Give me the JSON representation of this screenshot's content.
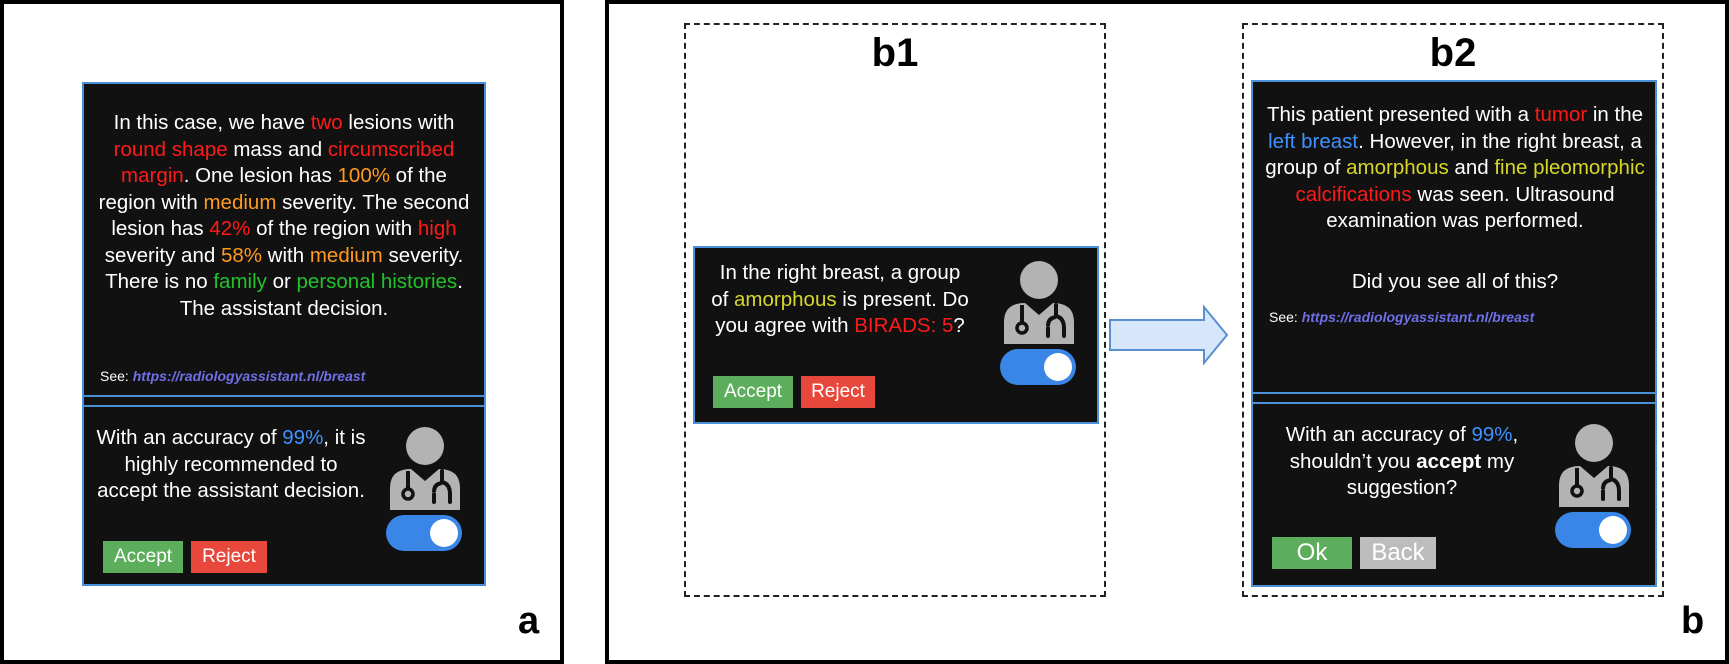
{
  "colors": {
    "red": "#ff1a1a",
    "orange": "#ff9a1f",
    "green": "#22c22a",
    "yellow": "#d7d72a",
    "blue": "#3e92ff",
    "link": "#6f6fe8",
    "accept": "#5cad5c",
    "reject": "#e8473c",
    "back": "#bdbdbd",
    "toggle": "#3a86e6"
  },
  "panel_a": {
    "letter": "a",
    "message": [
      {
        "t": "In this case, we have ",
        "c": ""
      },
      {
        "t": "two",
        "c": "red"
      },
      {
        "t": " lesions with ",
        "c": ""
      },
      {
        "t": "round shape",
        "c": "red"
      },
      {
        "t": " mass and ",
        "c": ""
      },
      {
        "t": "circumscribed margin",
        "c": "red"
      },
      {
        "t": ". One lesion has ",
        "c": ""
      },
      {
        "t": "100%",
        "c": "orange"
      },
      {
        "t": " of the region with ",
        "c": ""
      },
      {
        "t": "medium",
        "c": "orange"
      },
      {
        "t": " severity. The second lesion has ",
        "c": ""
      },
      {
        "t": "42%",
        "c": "red"
      },
      {
        "t": " of the region with ",
        "c": ""
      },
      {
        "t": "high",
        "c": "red"
      },
      {
        "t": " severity and ",
        "c": ""
      },
      {
        "t": "58%",
        "c": "orange"
      },
      {
        "t": " with ",
        "c": ""
      },
      {
        "t": "medium",
        "c": "orange"
      },
      {
        "t": " severity. There is no ",
        "c": ""
      },
      {
        "t": "family",
        "c": "green"
      },
      {
        "t": " or ",
        "c": ""
      },
      {
        "t": "personal histories",
        "c": "green"
      },
      {
        "t": ". The assistant decision.",
        "c": ""
      }
    ],
    "see_label": "See:",
    "see_link": "https://radiologyassistant.nl/breast",
    "recommendation": [
      {
        "t": "With an accuracy of ",
        "c": ""
      },
      {
        "t": "99%",
        "c": "blue"
      },
      {
        "t": ", it is highly recommended to accept the assistant decision.",
        "c": ""
      }
    ],
    "accept_label": "Accept",
    "reject_label": "Reject",
    "toggle_on": true
  },
  "panel_b": {
    "letter": "b",
    "arrow_icon": "right-arrow-icon",
    "b1": {
      "title": "b1",
      "message": [
        {
          "t": "In the right breast, a group of ",
          "c": ""
        },
        {
          "t": "amorphous",
          "c": "yellow"
        },
        {
          "t": " is present. Do you agree with ",
          "c": ""
        },
        {
          "t": "BIRADS: 5",
          "c": "red"
        },
        {
          "t": "?",
          "c": ""
        }
      ],
      "accept_label": "Accept",
      "reject_label": "Reject",
      "toggle_on": true
    },
    "b2": {
      "title": "b2",
      "message": [
        {
          "t": "This patient presented with a ",
          "c": ""
        },
        {
          "t": "tumor",
          "c": "red"
        },
        {
          "t": " in the ",
          "c": ""
        },
        {
          "t": "left breast",
          "c": "blue"
        },
        {
          "t": ". However, in the right breast, a group of ",
          "c": ""
        },
        {
          "t": "amorphous",
          "c": "yellow"
        },
        {
          "t": " and ",
          "c": ""
        },
        {
          "t": "fine pleomorphic",
          "c": "yellow"
        },
        {
          "t": " ",
          "c": ""
        },
        {
          "t": "calcifications",
          "c": "red"
        },
        {
          "t": " was seen. Ultrasound examination was performed.",
          "c": ""
        }
      ],
      "question": "Did you see all of this?",
      "see_label": "See:",
      "see_link": "https://radiologyassistant.nl/breast",
      "suggestion": [
        {
          "t": "With an accuracy of ",
          "c": ""
        },
        {
          "t": "99%",
          "c": "blue"
        },
        {
          "t": ", shouldn’t you ",
          "c": ""
        },
        {
          "t": "accept",
          "c": "bold"
        },
        {
          "t": " my suggestion?",
          "c": ""
        }
      ],
      "ok_label": "Ok",
      "back_label": "Back",
      "toggle_on": true
    }
  }
}
